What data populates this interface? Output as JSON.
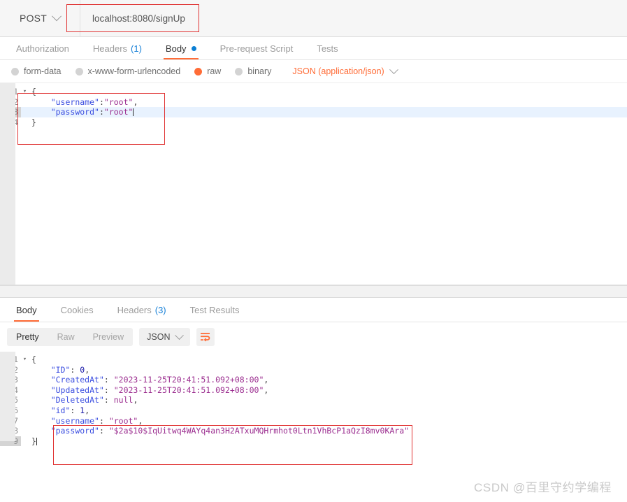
{
  "request": {
    "method": "POST",
    "url": "localhost:8080/signUp",
    "tabs": [
      {
        "label": "Authorization",
        "count": "",
        "active": false,
        "dot": false
      },
      {
        "label": "Headers",
        "count": "(1)",
        "active": false,
        "dot": false
      },
      {
        "label": "Body",
        "count": "",
        "active": true,
        "dot": true
      },
      {
        "label": "Pre-request Script",
        "count": "",
        "active": false,
        "dot": false
      },
      {
        "label": "Tests",
        "count": "",
        "active": false,
        "dot": false
      }
    ],
    "body_types": [
      {
        "label": "form-data",
        "selected": false
      },
      {
        "label": "x-www-form-urlencoded",
        "selected": false
      },
      {
        "label": "raw",
        "selected": true
      },
      {
        "label": "binary",
        "selected": false
      }
    ],
    "content_type": "JSON (application/json)",
    "body_lines": [
      {
        "no": "1",
        "fold": "▾",
        "highlight": false
      },
      {
        "no": "2",
        "fold": "",
        "highlight": false
      },
      {
        "no": "3",
        "fold": "",
        "highlight": true
      },
      {
        "no": "4",
        "fold": "",
        "highlight": false
      }
    ],
    "body_text": {
      "open_brace": "{",
      "username_key": "\"username\"",
      "username_val": "\"root\"",
      "password_key": "\"password\"",
      "password_val": "\"root\"",
      "comma": ",",
      "colon": ":",
      "close_brace": "}"
    }
  },
  "response": {
    "tabs": [
      {
        "label": "Body",
        "count": "",
        "active": true
      },
      {
        "label": "Cookies",
        "count": "",
        "active": false
      },
      {
        "label": "Headers",
        "count": "(3)",
        "active": false
      },
      {
        "label": "Test Results",
        "count": "",
        "active": false
      }
    ],
    "view_modes": [
      {
        "label": "Pretty",
        "active": true
      },
      {
        "label": "Raw",
        "active": false
      },
      {
        "label": "Preview",
        "active": false
      }
    ],
    "format": "JSON",
    "wrap_icon": "wrap-text-icon",
    "lines": [
      {
        "no": "1",
        "fold": "▾"
      },
      {
        "no": "2",
        "fold": ""
      },
      {
        "no": "3",
        "fold": ""
      },
      {
        "no": "4",
        "fold": ""
      },
      {
        "no": "5",
        "fold": ""
      },
      {
        "no": "6",
        "fold": ""
      },
      {
        "no": "7",
        "fold": ""
      },
      {
        "no": "8",
        "fold": ""
      },
      {
        "no": "9",
        "fold": ""
      }
    ],
    "json": {
      "open_brace": "{",
      "close_brace": "}",
      "k_id_upper": "\"ID\"",
      "v_id_upper": "0",
      "k_created": "\"CreatedAt\"",
      "v_created": "\"2023-11-25T20:41:51.092+08:00\"",
      "k_updated": "\"UpdatedAt\"",
      "v_updated": "\"2023-11-25T20:41:51.092+08:00\"",
      "k_deleted": "\"DeletedAt\"",
      "v_deleted": "null",
      "k_id": "\"id\"",
      "v_id": "1",
      "k_username": "\"username\"",
      "v_username": "\"root\"",
      "k_password": "\"password\"",
      "v_password": "\"$2a$10$IqUitwq4WAYq4an3H2ATxuMQHrmhot0Ltn1VhBcP1aQzI8mv0KAra\"",
      "comma": ",",
      "colon": ": "
    }
  },
  "watermark": "CSDN @百里守约学编程",
  "colors": {
    "accent": "#ff6c37",
    "annotation": "#e03131",
    "link": "#1a82d8",
    "string": "#3b4ee0",
    "key": "#9b2d8f"
  }
}
